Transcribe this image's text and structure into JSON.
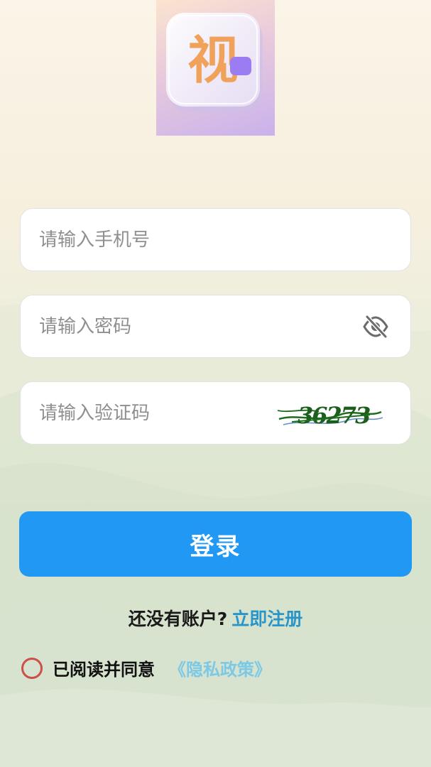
{
  "form": {
    "phone_placeholder": "请输入手机号",
    "password_placeholder": "请输入密码",
    "captcha_placeholder": "请输入验证码",
    "captcha_code": "36273"
  },
  "login": {
    "label": "登录"
  },
  "signup": {
    "question": "还没有账户?",
    "link": "立即注册"
  },
  "agreement": {
    "text": "已阅读并同意",
    "policy_link": "《隐私政策》"
  },
  "logo": {
    "glyph": "视"
  },
  "icons": {
    "password_toggle": "eye-off-icon",
    "agree_radio": "radio-circle-icon"
  },
  "colors": {
    "primary": "#2198f3",
    "signup_link": "#2a95c7",
    "policy_link": "#7cc9e6",
    "radio_border": "#cc4f4a"
  }
}
